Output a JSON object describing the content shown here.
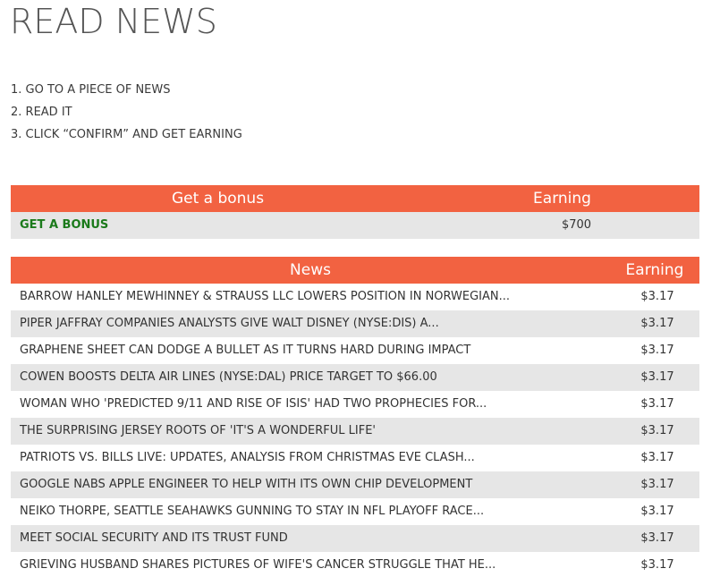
{
  "page": {
    "title": "READ NEWS"
  },
  "steps": [
    "1. GO TO A PIECE OF NEWS",
    "2. READ IT",
    "3. CLICK “CONFIRM” AND GET EARNING"
  ],
  "bonus_table": {
    "headers": {
      "title": "Get a bonus",
      "earning": "Earning"
    },
    "row": {
      "label": "GET A BONUS",
      "earning": "$700"
    }
  },
  "news_table": {
    "headers": {
      "title": "News",
      "earning": "Earning"
    },
    "rows": [
      {
        "title": "BARROW HANLEY MEWHINNEY & STRAUSS LLC LOWERS POSITION IN NORWEGIAN...",
        "earning": "$3.17"
      },
      {
        "title": "PIPER JAFFRAY COMPANIES ANALYSTS GIVE WALT DISNEY (NYSE:DIS) A...",
        "earning": "$3.17"
      },
      {
        "title": "GRAPHENE SHEET CAN DODGE A BULLET AS IT TURNS HARD DURING IMPACT",
        "earning": "$3.17"
      },
      {
        "title": "COWEN BOOSTS DELTA AIR LINES (NYSE:DAL) PRICE TARGET TO $66.00",
        "earning": "$3.17"
      },
      {
        "title": "WOMAN WHO 'PREDICTED 9/11 AND RISE OF ISIS' HAD TWO PROPHECIES FOR...",
        "earning": "$3.17"
      },
      {
        "title": "THE SURPRISING JERSEY ROOTS OF 'IT'S A WONDERFUL LIFE'",
        "earning": "$3.17"
      },
      {
        "title": "PATRIOTS VS. BILLS LIVE: UPDATES, ANALYSIS FROM CHRISTMAS EVE CLASH...",
        "earning": "$3.17"
      },
      {
        "title": "GOOGLE NABS APPLE ENGINEER TO HELP WITH ITS OWN CHIP DEVELOPMENT",
        "earning": "$3.17"
      },
      {
        "title": "NEIKO THORPE, SEATTLE SEAHAWKS GUNNING TO STAY IN NFL PLAYOFF RACE...",
        "earning": "$3.17"
      },
      {
        "title": "MEET SOCIAL SECURITY AND ITS TRUST FUND",
        "earning": "$3.17"
      },
      {
        "title": "GRIEVING HUSBAND SHARES PICTURES OF WIFE'S CANCER STRUGGLE THAT HE...",
        "earning": "$3.17"
      }
    ]
  },
  "colors": {
    "header_bg": "#f26241",
    "bonus_link": "#1b7a1b",
    "stripe": "#e6e6e6"
  }
}
